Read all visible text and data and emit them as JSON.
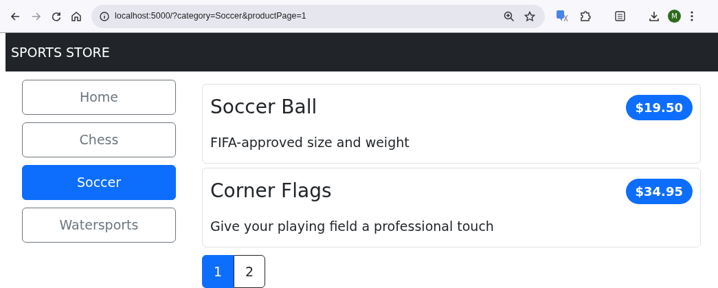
{
  "browser": {
    "url": "localhost:5000/?category=Soccer&productPage=1",
    "profile_initial": "M"
  },
  "navbar": {
    "brand": "SPORTS STORE"
  },
  "categories": [
    {
      "label": "Home",
      "selected": false
    },
    {
      "label": "Chess",
      "selected": false
    },
    {
      "label": "Soccer",
      "selected": true
    },
    {
      "label": "Watersports",
      "selected": false
    }
  ],
  "products": [
    {
      "name": "Soccer Ball",
      "price": "$19.50",
      "description": "FIFA-approved size and weight"
    },
    {
      "name": "Corner Flags",
      "price": "$34.95",
      "description": "Give your playing field a professional touch"
    }
  ],
  "pagination": [
    {
      "label": "1",
      "selected": true
    },
    {
      "label": "2",
      "selected": false
    }
  ]
}
